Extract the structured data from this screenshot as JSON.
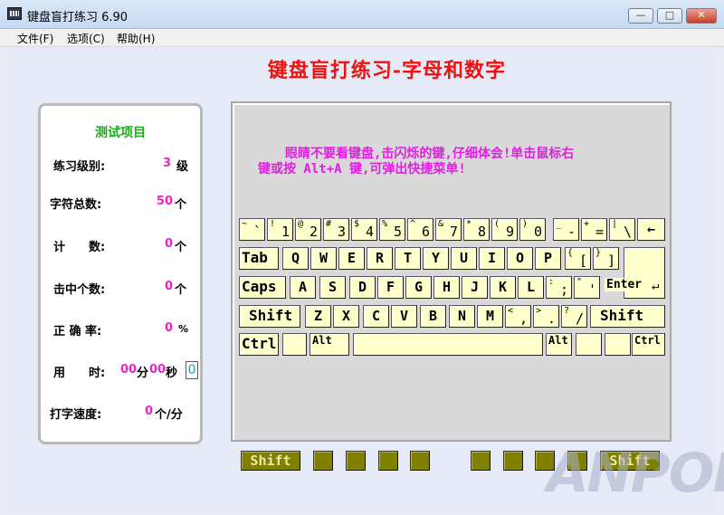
{
  "window": {
    "title": "键盘盲打练习 6.90",
    "controls": {
      "minimize": "—",
      "maximize": "□",
      "close": "✕"
    }
  },
  "menu": {
    "items": [
      "文件(F)",
      "选项(C)",
      "帮助(H)"
    ]
  },
  "page": {
    "title": "键盘盲打练习-字母和数字"
  },
  "stats": {
    "title": "测试项目",
    "level": {
      "label": "练习级别:",
      "value": "3",
      "unit": "级"
    },
    "total_chars": {
      "label": "字符总数:",
      "value": "50",
      "unit": "个"
    },
    "count": {
      "label": "计　　数:",
      "value": "0",
      "unit": "个"
    },
    "hits": {
      "label": "击中个数:",
      "value": "0",
      "unit": "个"
    },
    "accuracy": {
      "label": "正 确 率:",
      "value": "0",
      "unit": "%"
    },
    "time": {
      "label": "用　　时:",
      "minutes": "00",
      "min_unit": "分",
      "seconds": "00",
      "sec_unit": "秒",
      "box": "0"
    },
    "speed": {
      "label": "打字速度:",
      "value": "0",
      "unit": "个/分"
    }
  },
  "hint": {
    "line1": "眼睛不要看键盘,击闪烁的键,仔细体会!单击鼠标右",
    "line2": "键或按 Alt+A 键,可弹出快捷菜单!"
  },
  "keyboard": {
    "row1": [
      {
        "top": "~",
        "bot": "`"
      },
      {
        "top": "!",
        "bot": "1"
      },
      {
        "top": "@",
        "bot": "2"
      },
      {
        "top": "#",
        "bot": "3"
      },
      {
        "top": "$",
        "bot": "4"
      },
      {
        "top": "%",
        "bot": "5"
      },
      {
        "top": "^",
        "bot": "6"
      },
      {
        "top": "&",
        "bot": "7"
      },
      {
        "top": "*",
        "bot": "8"
      },
      {
        "top": "(",
        "bot": "9"
      },
      {
        "top": ")",
        "bot": "0"
      },
      {
        "top": "_",
        "bot": "-"
      },
      {
        "top": "+",
        "bot": "="
      },
      {
        "top": "|",
        "bot": "\\"
      }
    ],
    "backspace": "←",
    "tab": "Tab",
    "row2": [
      "Q",
      "W",
      "E",
      "R",
      "T",
      "Y",
      "U",
      "I",
      "O",
      "P"
    ],
    "row2_sym": [
      {
        "top": "{",
        "bot": "["
      },
      {
        "top": "}",
        "bot": "]"
      }
    ],
    "enter": "Enter",
    "caps": "Caps",
    "row3": [
      "A",
      "S",
      "D",
      "F",
      "G",
      "H",
      "J",
      "K",
      "L"
    ],
    "row3_sym": [
      {
        "top": ":",
        "bot": ";"
      },
      {
        "top": "\"",
        "bot": "'"
      }
    ],
    "lshift": "Shift",
    "row4": [
      "Z",
      "X",
      "C",
      "V",
      "B",
      "N",
      "M"
    ],
    "row4_sym": [
      {
        "top": "<",
        "bot": ","
      },
      {
        "top": ">",
        "bot": "."
      },
      {
        "top": "?",
        "bot": "/"
      }
    ],
    "rshift": "Shift",
    "lctrl": "Ctrl",
    "lalt": "Alt",
    "ralt": "Alt",
    "rctrl": "Ctrl"
  },
  "fingers": {
    "left_shift": "Shift",
    "right_shift": "Shift"
  },
  "watermark": "ANPON"
}
